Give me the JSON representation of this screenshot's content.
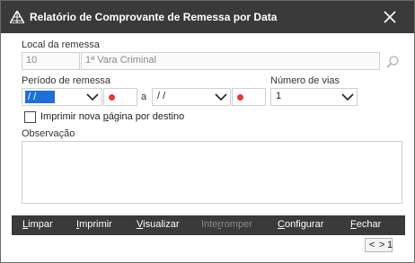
{
  "window": {
    "title": "Relatório de Comprovante de Remessa por Data"
  },
  "local_remessa": {
    "label": "Local da remessa",
    "code": "10",
    "name": "1ª Vara Criminal"
  },
  "periodo": {
    "label": "Período de remessa",
    "start_date": "/ /",
    "separator": "a",
    "end_date": "/ /"
  },
  "vias": {
    "label": "Número de vias",
    "value": "1"
  },
  "nova_pagina": {
    "label_pre": "Imprimir nova ",
    "label_accel": "p",
    "label_post": "ágina por destino",
    "checked": false
  },
  "observacao": {
    "label": "Observação",
    "value": ""
  },
  "toolbar": {
    "limpar": {
      "accel": "L",
      "rest": "impar"
    },
    "imprimir": {
      "accel": "I",
      "rest": "mprimir"
    },
    "visualizar": {
      "accel": "V",
      "rest": "isualizar"
    },
    "interromper": {
      "pre": "Inte",
      "accel": "r",
      "rest": "romper"
    },
    "configurar": {
      "accel": "C",
      "rest": "onfigurar"
    },
    "fechar": {
      "accel": "F",
      "rest": "echar"
    }
  },
  "pager": {
    "prev": "<",
    "next": ">",
    "page": "1"
  },
  "colors": {
    "titlebar": "#3a3a3a",
    "selection": "#1e6fd8",
    "required_dot": "#e53935"
  }
}
